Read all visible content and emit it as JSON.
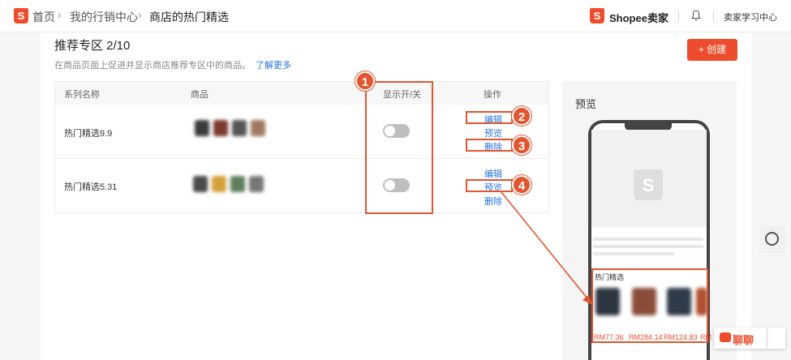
{
  "breadcrumb": {
    "home": "首页",
    "marketing": "我的行销中心",
    "current": "商店的热门精选"
  },
  "header": {
    "seller_brand": "Shopee卖家",
    "learning_center": "卖家学习中心",
    "logo_letter": "S"
  },
  "page": {
    "title": "推荐专区 2/10",
    "subtitle": "在商品页面上促进并显示商店推荐专区中的商品。",
    "learn_more": "了解更多",
    "create_button": "+ 创建"
  },
  "table": {
    "columns": [
      "系列名称",
      "商品",
      "显示开/关",
      "操作"
    ],
    "rows": [
      {
        "name": "热门精选9.9",
        "toggle_on": false,
        "actions": [
          "编辑",
          "预览",
          "删除"
        ],
        "thumb_colors": [
          "#3b3b3b",
          "#7a3b2e",
          "#555555",
          "#a07a60"
        ]
      },
      {
        "name": "热门精选5.31",
        "toggle_on": false,
        "actions": [
          "编辑",
          "预览",
          "删除"
        ],
        "thumb_colors": [
          "#4a4a4a",
          "#d4a23a",
          "#5f7f5a",
          "#777777"
        ]
      }
    ]
  },
  "annotations": {
    "callouts": [
      "1",
      "2",
      "3",
      "4"
    ],
    "accent": "#e2552f"
  },
  "preview": {
    "title": "预览",
    "section_label": "热门精选",
    "prices": [
      "RM77.36",
      "RM284.14",
      "RM124.83",
      "RM"
    ],
    "product_colors": [
      "#2d3540",
      "#8a4d3a",
      "#2f3b4a",
      "#b05030"
    ]
  },
  "widgets": {
    "chat_label": "聊聊",
    "brand_color": "#ee4d2d"
  }
}
